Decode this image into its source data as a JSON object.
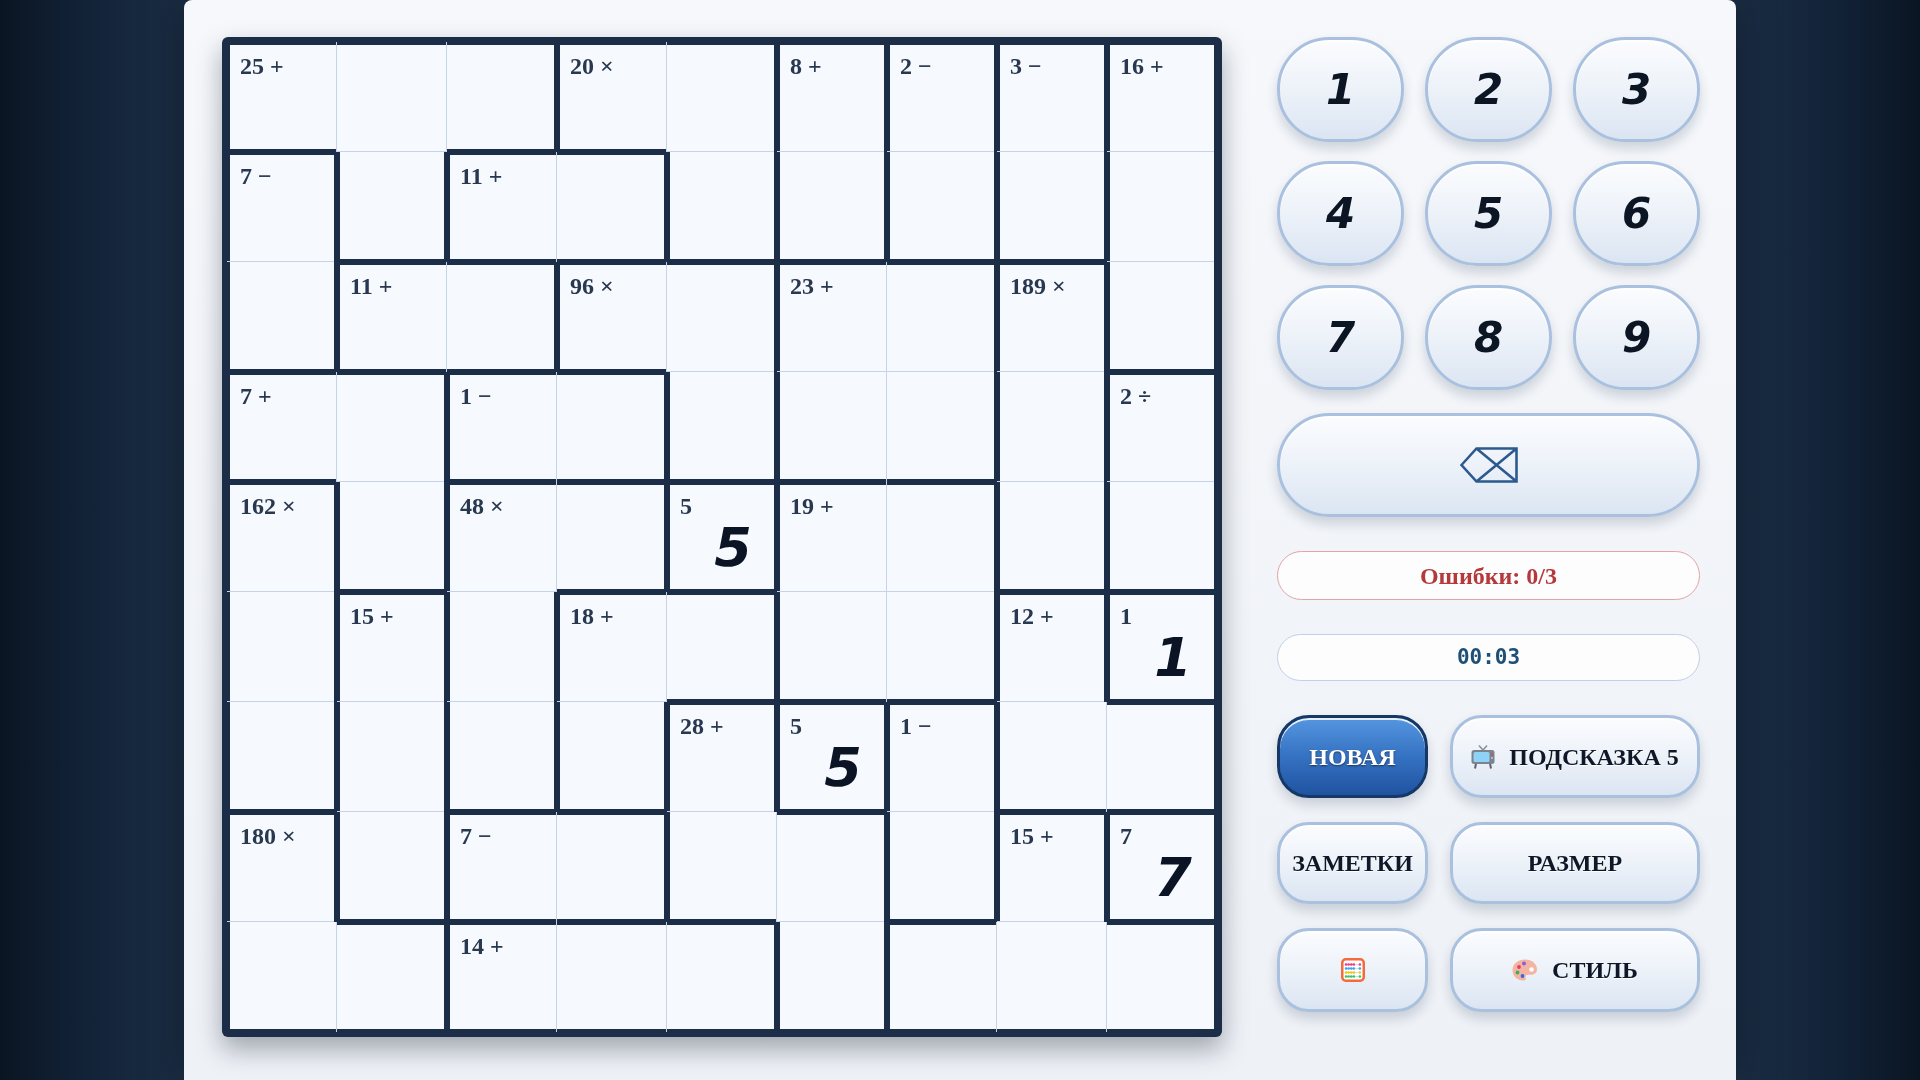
{
  "board": {
    "rows": [
      {
        "cells": [
          {
            "clue": "25 +",
            "wall_right": false,
            "wall_bottom": true
          },
          {
            "wall_right": false,
            "wall_bottom": false
          },
          {
            "wall_right": true,
            "wall_bottom": true
          },
          {
            "clue": "20 ×",
            "wall_right": false,
            "wall_bottom": true
          },
          {
            "wall_right": true,
            "wall_bottom": false
          },
          {
            "clue": "8 +",
            "wall_right": true,
            "wall_bottom": false
          },
          {
            "clue": "2 −",
            "wall_right": true,
            "wall_bottom": false
          },
          {
            "clue": "3 −",
            "wall_right": true,
            "wall_bottom": false
          },
          {
            "clue": "16 +",
            "wall_right": true,
            "wall_bottom": false
          }
        ]
      },
      {
        "cells": [
          {
            "clue": "7 −",
            "wall_right": true,
            "wall_bottom": false
          },
          {
            "wall_right": true,
            "wall_bottom": true
          },
          {
            "clue": "11 +",
            "wall_right": false,
            "wall_bottom": true
          },
          {
            "wall_right": true,
            "wall_bottom": true
          },
          {
            "wall_right": true,
            "wall_bottom": true
          },
          {
            "wall_right": true,
            "wall_bottom": true
          },
          {
            "wall_right": true,
            "wall_bottom": true
          },
          {
            "wall_right": true,
            "wall_bottom": true
          },
          {
            "wall_right": true,
            "wall_bottom": false
          }
        ]
      },
      {
        "cells": [
          {
            "wall_right": true,
            "wall_bottom": true
          },
          {
            "clue": "11 +",
            "wall_right": false,
            "wall_bottom": true
          },
          {
            "wall_right": true,
            "wall_bottom": true
          },
          {
            "clue": "96 ×",
            "wall_right": false,
            "wall_bottom": true
          },
          {
            "wall_right": true,
            "wall_bottom": false
          },
          {
            "clue": "23 +",
            "wall_right": false,
            "wall_bottom": false
          },
          {
            "wall_right": true,
            "wall_bottom": false
          },
          {
            "clue": "189 ×",
            "wall_right": true,
            "wall_bottom": false
          },
          {
            "wall_right": true,
            "wall_bottom": true
          }
        ]
      },
      {
        "cells": [
          {
            "clue": "7 +",
            "wall_right": false,
            "wall_bottom": true
          },
          {
            "wall_right": true,
            "wall_bottom": false
          },
          {
            "clue": "1 −",
            "wall_right": false,
            "wall_bottom": true
          },
          {
            "wall_right": true,
            "wall_bottom": true
          },
          {
            "wall_right": true,
            "wall_bottom": true
          },
          {
            "wall_right": false,
            "wall_bottom": true
          },
          {
            "wall_right": true,
            "wall_bottom": true
          },
          {
            "wall_right": true,
            "wall_bottom": false
          },
          {
            "clue": "2 ÷",
            "wall_right": true,
            "wall_bottom": false
          }
        ]
      },
      {
        "cells": [
          {
            "clue": "162 ×",
            "wall_right": true,
            "wall_bottom": false
          },
          {
            "wall_right": true,
            "wall_bottom": true
          },
          {
            "clue": "48 ×",
            "wall_right": false,
            "wall_bottom": false
          },
          {
            "wall_right": true,
            "wall_bottom": true
          },
          {
            "clue": "5",
            "value": "5",
            "wall_right": true,
            "wall_bottom": true
          },
          {
            "clue": "19 +",
            "wall_right": false,
            "wall_bottom": false
          },
          {
            "wall_right": true,
            "wall_bottom": false
          },
          {
            "wall_right": true,
            "wall_bottom": true
          },
          {
            "wall_right": true,
            "wall_bottom": true
          }
        ]
      },
      {
        "cells": [
          {
            "wall_right": true,
            "wall_bottom": false
          },
          {
            "clue": "15 +",
            "wall_right": true,
            "wall_bottom": false
          },
          {
            "wall_right": true,
            "wall_bottom": false
          },
          {
            "clue": "18 +",
            "wall_right": false,
            "wall_bottom": false
          },
          {
            "wall_right": true,
            "wall_bottom": true
          },
          {
            "wall_right": false,
            "wall_bottom": true
          },
          {
            "wall_right": true,
            "wall_bottom": true
          },
          {
            "clue": "12 +",
            "wall_right": true,
            "wall_bottom": false
          },
          {
            "clue": "1",
            "value": "1",
            "wall_right": true,
            "wall_bottom": true
          }
        ]
      },
      {
        "cells": [
          {
            "wall_right": true,
            "wall_bottom": true
          },
          {
            "wall_right": true,
            "wall_bottom": false
          },
          {
            "wall_right": true,
            "wall_bottom": true
          },
          {
            "wall_right": true,
            "wall_bottom": true
          },
          {
            "clue": "28 +",
            "wall_right": true,
            "wall_bottom": false
          },
          {
            "clue": "5",
            "value": "5",
            "wall_right": true,
            "wall_bottom": true
          },
          {
            "clue": "1 −",
            "wall_right": true,
            "wall_bottom": false
          },
          {
            "wall_right": false,
            "wall_bottom": true
          },
          {
            "wall_right": true,
            "wall_bottom": true
          }
        ]
      },
      {
        "cells": [
          {
            "clue": "180 ×",
            "wall_right": true,
            "wall_bottom": false
          },
          {
            "wall_right": true,
            "wall_bottom": true
          },
          {
            "clue": "7 −",
            "wall_right": false,
            "wall_bottom": true
          },
          {
            "wall_right": true,
            "wall_bottom": true
          },
          {
            "wall_right": false,
            "wall_bottom": true
          },
          {
            "wall_right": true,
            "wall_bottom": false
          },
          {
            "wall_right": true,
            "wall_bottom": true
          },
          {
            "clue": "15 +",
            "wall_right": true,
            "wall_bottom": false
          },
          {
            "clue": "7",
            "value": "7",
            "wall_right": true,
            "wall_bottom": true
          }
        ]
      },
      {
        "cells": [
          {
            "wall_right": false,
            "wall_bottom": true
          },
          {
            "wall_right": true,
            "wall_bottom": true
          },
          {
            "clue": "14 +",
            "wall_right": false,
            "wall_bottom": true
          },
          {
            "wall_right": false,
            "wall_bottom": true
          },
          {
            "wall_right": true,
            "wall_bottom": true
          },
          {
            "wall_right": true,
            "wall_bottom": true
          },
          {
            "wall_right": false,
            "wall_bottom": true
          },
          {
            "wall_right": false,
            "wall_bottom": true
          },
          {
            "wall_right": true,
            "wall_bottom": true
          }
        ]
      }
    ]
  },
  "keypad": {
    "keys": [
      "1",
      "2",
      "3",
      "4",
      "5",
      "6",
      "7",
      "8",
      "9"
    ]
  },
  "status": {
    "mistakes": "Ошибки: 0/3",
    "timer": "00:03"
  },
  "actions": [
    {
      "label": "НОВАЯ",
      "kind": "new"
    },
    {
      "label": "ПОДСКАЗКА 5",
      "kind": "hint"
    },
    {
      "label": "ЗАМЕТКИ",
      "kind": "notes"
    },
    {
      "label": "РАЗМЕР",
      "kind": "size"
    },
    {
      "kind": "abacus"
    },
    {
      "label": "СТИЛЬ",
      "kind": "style"
    }
  ]
}
